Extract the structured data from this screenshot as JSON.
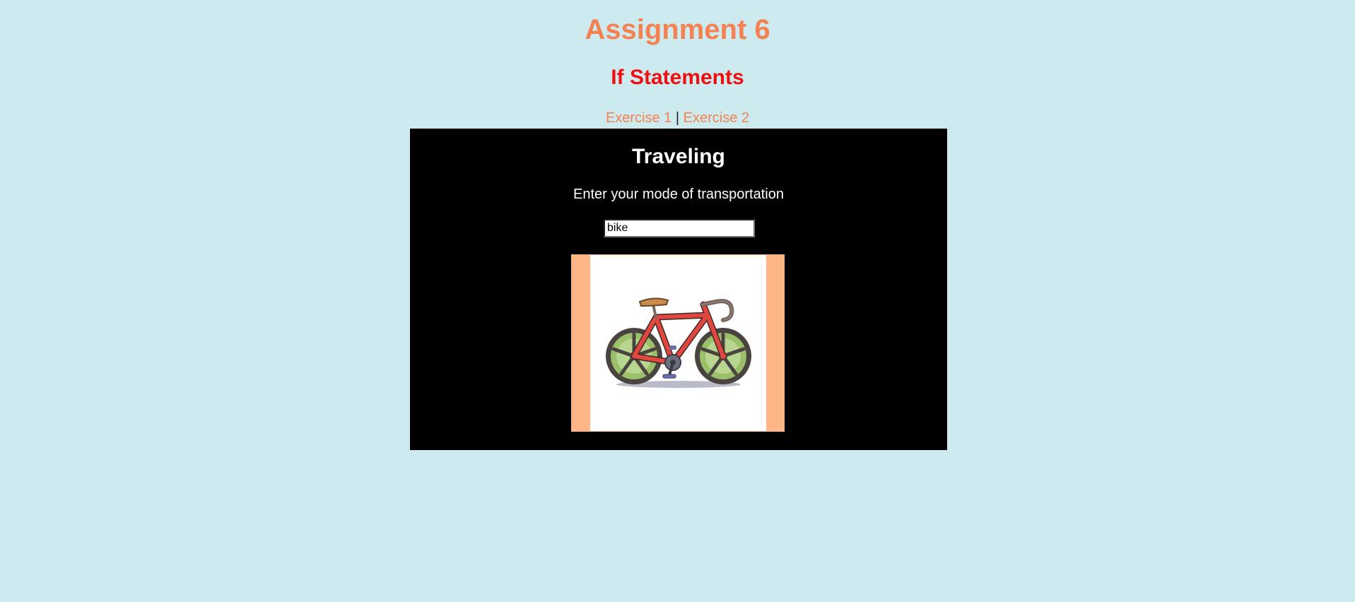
{
  "header": {
    "title": "Assignment 6",
    "subtitle": "If Statements"
  },
  "nav": {
    "links": [
      {
        "label": "Exercise 1"
      },
      {
        "label": "Exercise 2"
      }
    ],
    "separator": "|"
  },
  "panel": {
    "title": "Traveling",
    "prompt": "Enter your mode of transportation",
    "input_value": "bike",
    "image_subject": "bicycle-icon"
  },
  "colors": {
    "background": "#cdebee",
    "title": "#f58152",
    "subtitle": "#ee0f10",
    "link": "#f58152",
    "panel": "#000000",
    "image_frame": "#ffb686"
  }
}
